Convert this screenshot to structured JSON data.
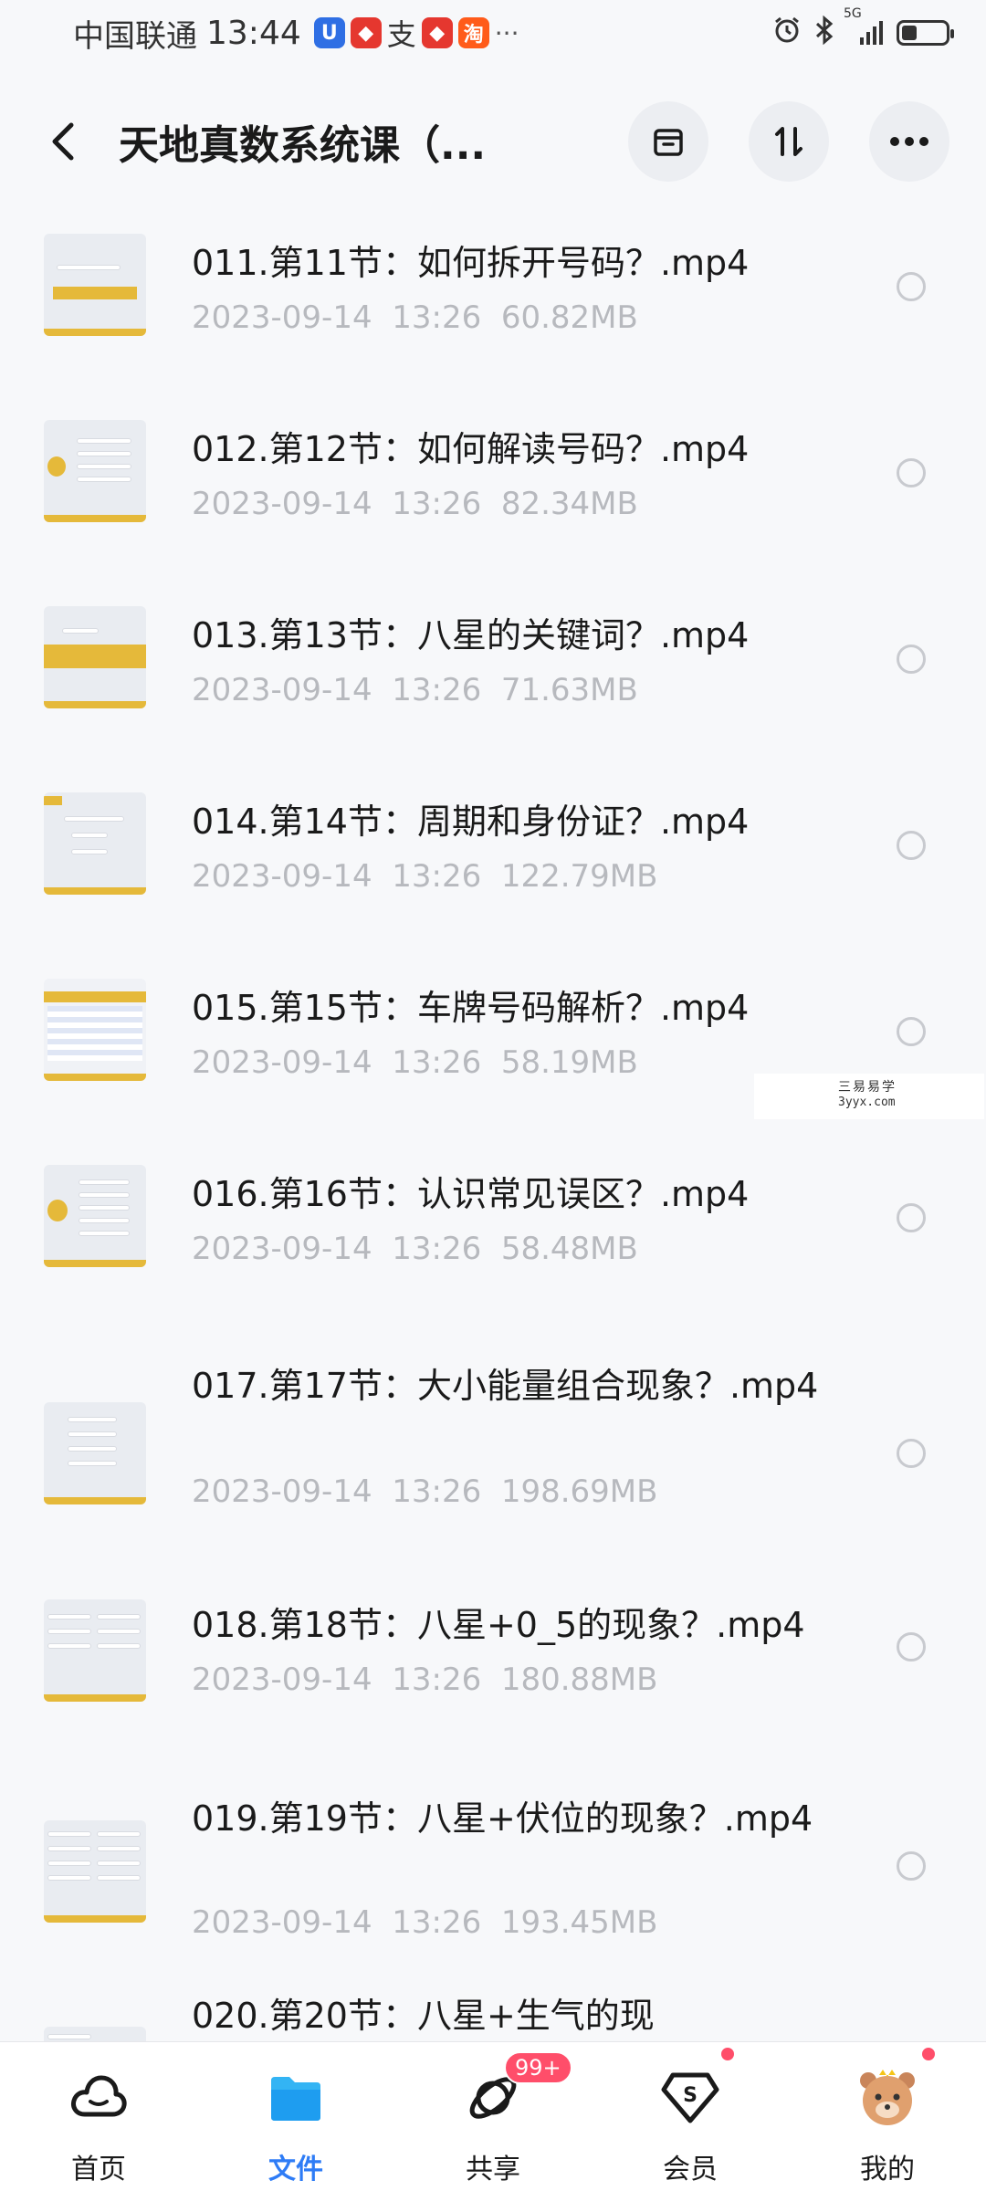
{
  "status_bar": {
    "carrier": "中国联通",
    "time": "13:44",
    "network": "5G",
    "battery_level": 0.35,
    "colors": {
      "app1": "#2f6fe4",
      "app2": "#e5372f",
      "app3": "#ff5b1a"
    }
  },
  "header": {
    "title": "天地真数系统课（...",
    "back_icon": "chevron-left-icon",
    "actions": [
      "archive-icon",
      "sort-icon",
      "more-icon"
    ]
  },
  "files": [
    {
      "name": "011.第11节：如何拆开号码？.mp4",
      "date": "2023-09-14",
      "time": "13:26",
      "size": "60.82MB"
    },
    {
      "name": "012.第12节：如何解读号码？.mp4",
      "date": "2023-09-14",
      "time": "13:26",
      "size": "82.34MB"
    },
    {
      "name": "013.第13节：八星的关键词？.mp4",
      "date": "2023-09-14",
      "time": "13:26",
      "size": "71.63MB"
    },
    {
      "name": "014.第14节：周期和身份证？.mp4",
      "date": "2023-09-14",
      "time": "13:26",
      "size": "122.79MB"
    },
    {
      "name": "015.第15节：车牌号码解析？.mp4",
      "date": "2023-09-14",
      "time": "13:26",
      "size": "58.19MB"
    },
    {
      "name": "016.第16节：认识常见误区？.mp4",
      "date": "2023-09-14",
      "time": "13:26",
      "size": "58.48MB"
    },
    {
      "name": "017.第17节：大小能量组合现象？.mp4",
      "date": "2023-09-14",
      "time": "13:26",
      "size": "198.69MB"
    },
    {
      "name": "018.第18节：八星+0_5的现象？.mp4",
      "date": "2023-09-14",
      "time": "13:26",
      "size": "180.88MB"
    },
    {
      "name": "019.第19节：八星+伏位的现象？.mp4",
      "date": "2023-09-14",
      "time": "13:26",
      "size": "193.45MB"
    },
    {
      "name": "020.第20节：八星+生气的现",
      "date": "",
      "time": "",
      "size": ""
    }
  ],
  "watermark": {
    "text_cn": "三易易学",
    "url": "3yyx.com"
  },
  "bottom_nav": {
    "items": [
      {
        "label": "首页",
        "icon": "cloud-icon"
      },
      {
        "label": "文件",
        "icon": "folder-icon"
      },
      {
        "label": "共享",
        "icon": "planet-icon"
      },
      {
        "label": "会员",
        "icon": "vip-diamond-icon"
      },
      {
        "label": "我的",
        "icon": "avatar-icon"
      }
    ],
    "share_badge": "99+",
    "active_color": "#2e7cf6",
    "badge_color": "#ff4e6a"
  }
}
